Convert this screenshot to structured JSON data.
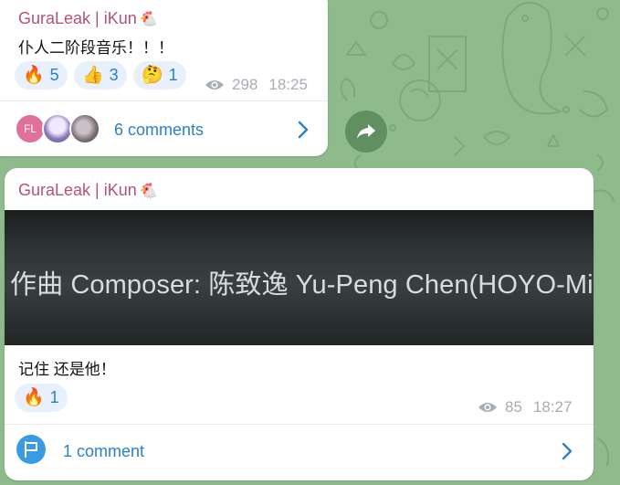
{
  "messages": [
    {
      "sender": "GuraLeak | iKun",
      "sender_emoji": "🐔",
      "text": "仆人二阶段音乐！！！",
      "reactions": [
        {
          "emoji": "🔥",
          "count": "5"
        },
        {
          "emoji": "👍",
          "count": "3"
        },
        {
          "emoji": "🤔",
          "count": "1"
        }
      ],
      "views": "298",
      "time": "18:25",
      "comments_label": "6 comments",
      "avatar_initials": "FL"
    },
    {
      "sender": "GuraLeak | iKun",
      "sender_emoji": "🐔",
      "media_caption": "作曲 Composer: 陈致逸 Yu-Peng Chen(HOYO-MiX)",
      "text": "记住 还是他！",
      "reactions": [
        {
          "emoji": "🔥",
          "count": "1"
        }
      ],
      "views": "85",
      "time": "18:27",
      "comments_label": "1 comment"
    }
  ],
  "colors": {
    "background": "#8fbb8c",
    "sender": "#b5527a",
    "accent": "#2b80c9",
    "meta": "#a7adb4"
  }
}
